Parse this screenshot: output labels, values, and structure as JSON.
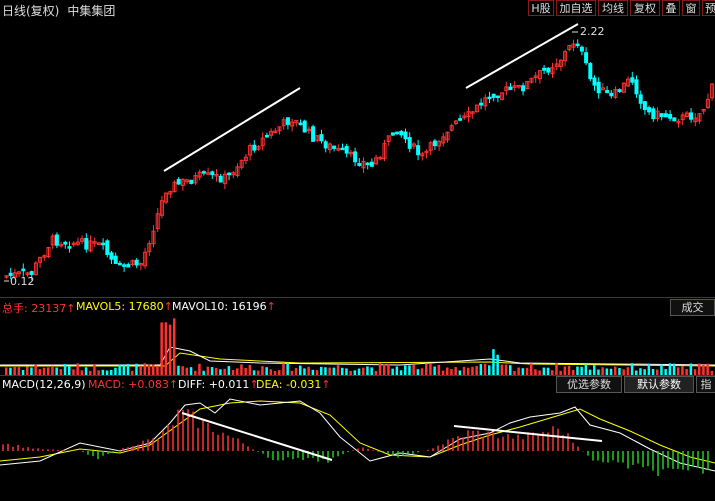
{
  "header": {
    "title": "日线(复权)",
    "stock_name": "中集集团",
    "buttons": [
      "H股",
      "加自选",
      "均线",
      "复权",
      "叠",
      "窗",
      "预"
    ]
  },
  "kline": {
    "high_label": "2.22",
    "low_label": "0.12",
    "up_color": "#ff3232",
    "down_color": "#00ffff"
  },
  "volume": {
    "label": "总手: 23137",
    "arrow1": "↑",
    "mavol5": "MAVOL5: 17680",
    "arrow2": "↑",
    "mavol10": "MAVOL10: 16196",
    "arrow3": "↑",
    "side_button": "成交"
  },
  "macd": {
    "name": "MACD(12,26,9)",
    "macd": "MACD: +0.083",
    "arrow1": "↑",
    "diff": "DIFF: +0.011",
    "arrow2": "↑",
    "dea": "DEA: -0.031",
    "arrow3": "↑",
    "buttons": [
      "优选参数",
      "默认参数",
      "指"
    ]
  }
}
